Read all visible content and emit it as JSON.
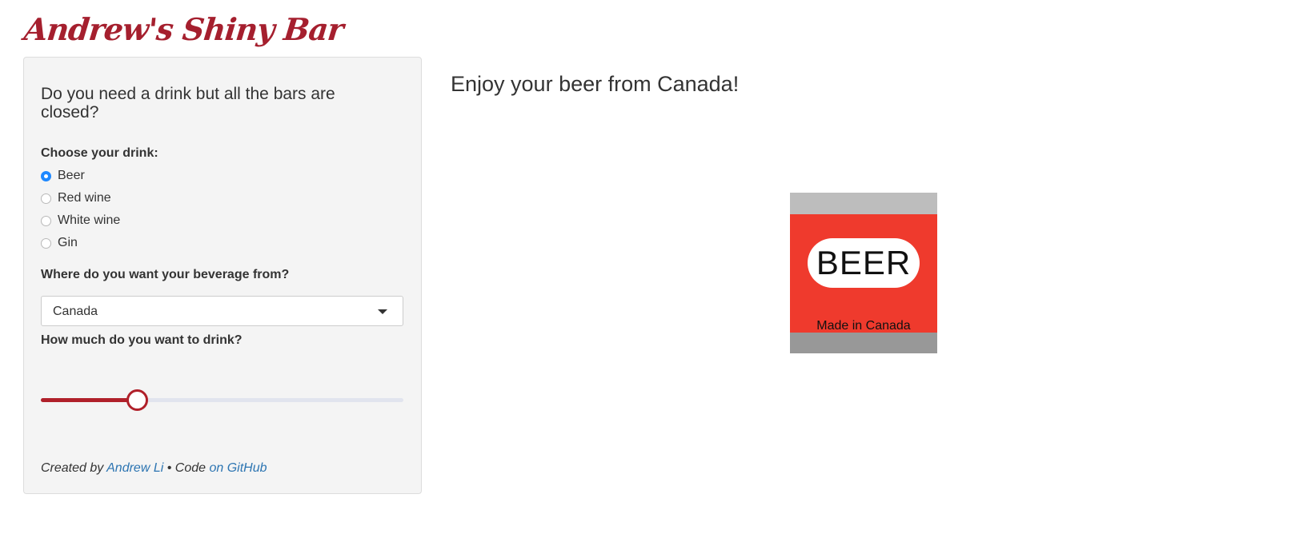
{
  "app": {
    "title": "Andrew's Shiny Bar"
  },
  "colors": {
    "brand": "#a51f2e",
    "link": "#2d75b2",
    "radio_checked": "#1e88ff",
    "slider_accent": "#b0202a",
    "can_body": "#ef3a2d"
  },
  "sidebar": {
    "heading": "Do you need a drink but all the bars are closed?",
    "drink_label": "Choose your drink:",
    "drinks": [
      {
        "label": "Beer",
        "checked": true
      },
      {
        "label": "Red wine",
        "checked": false
      },
      {
        "label": "White wine",
        "checked": false
      },
      {
        "label": "Gin",
        "checked": false
      }
    ],
    "origin_label": "Where do you want your beverage from?",
    "origin_value": "Canada",
    "amount_label": "How much do you want to drink?",
    "amount_slider": {
      "fraction": 0.265
    },
    "footer": {
      "prefix": "Created by",
      "author_link": "Andrew Li",
      "separator": "• Code",
      "code_link": "on GitHub"
    }
  },
  "main": {
    "heading": "Enjoy your beer from Canada!",
    "can": {
      "label": "BEER",
      "origin": "Made in Canada"
    }
  }
}
